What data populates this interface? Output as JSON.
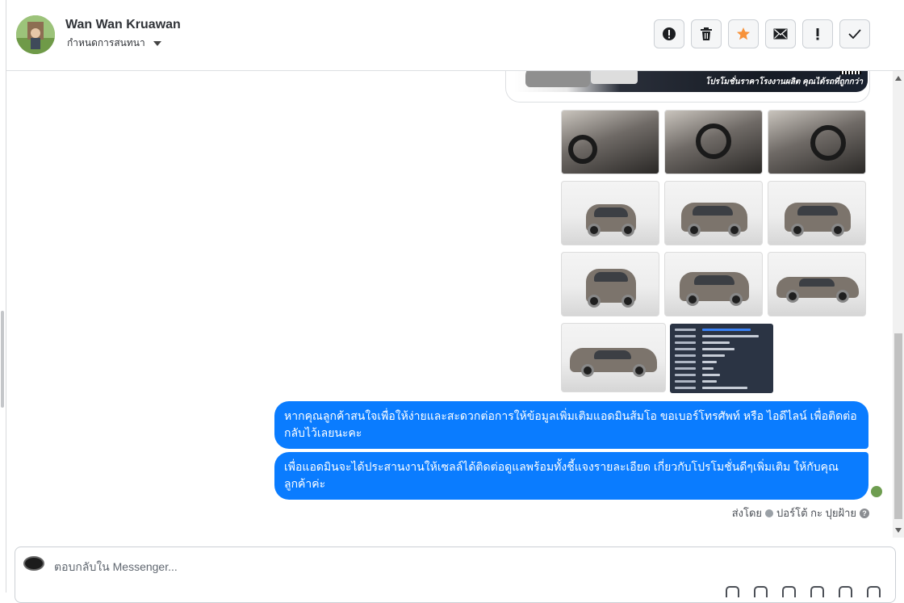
{
  "header": {
    "contact_name": "Wan Wan Kruawan",
    "assign_label": "กำหนดการสนทนา",
    "actions": [
      {
        "name": "spam-button",
        "glyph": "!",
        "style": "circle"
      },
      {
        "name": "delete-button",
        "glyph": "trash"
      },
      {
        "name": "star-button",
        "glyph": "star",
        "color": "#f7923a"
      },
      {
        "name": "mark-unread-button",
        "glyph": "envelope"
      },
      {
        "name": "follow-up-button",
        "glyph": "!"
      },
      {
        "name": "done-button",
        "glyph": "check"
      }
    ]
  },
  "banner": {
    "promo_text": "โปรโมชั่นราคาโรงงานผลิต คุณได้รถที่ถูกกว่า"
  },
  "messages": [
    {
      "text": "หากคุณลูกค้าสนใจเพื่อให้ง่ายและสะดวกต่อการให้ข้อมูลเพิ่มเติมแอดมินส้มโอ ขอเบอร์โทรศัพท์ หรือ ไอดีไลน์ เพื่อติดต่อกลับไว้เลยนะคะ"
    },
    {
      "text": "เพื่อแอดมินจะได้ประสานงานให้เซลล์ได้ติดต่อดูแลพร้อมทั้งชี้แจงรายละเอียด เกี่ยวกับโปรโมชั่นดีๆเพิ่มเติม ให้กับคุณลูกค้าค่ะ"
    }
  ],
  "sent_by": {
    "prefix": "ส่งโดย",
    "author": "ปอร์โต้ กะ ปุยฝ้าย",
    "help": "?"
  },
  "composer": {
    "placeholder": "ตอบกลับใน Messenger..."
  },
  "colors": {
    "bubble": "#0a7cff",
    "star": "#f7923a"
  }
}
